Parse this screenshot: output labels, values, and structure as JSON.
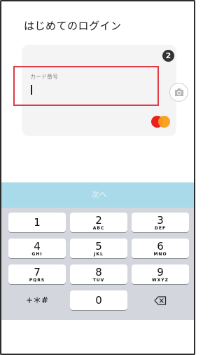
{
  "header": {
    "title": "はじめてのログイン"
  },
  "card": {
    "field_label": "カード番号",
    "field_value": "",
    "brand_icon": "mastercard-logo"
  },
  "step_badge": "2",
  "camera_button_icon": "camera-icon",
  "next_button_label": "次へ",
  "keypad": {
    "keys": [
      {
        "num": "1",
        "letters": ""
      },
      {
        "num": "2",
        "letters": "ABC"
      },
      {
        "num": "3",
        "letters": "DEF"
      },
      {
        "num": "4",
        "letters": "GHI"
      },
      {
        "num": "5",
        "letters": "JKL"
      },
      {
        "num": "6",
        "letters": "MNO"
      },
      {
        "num": "7",
        "letters": "PQRS"
      },
      {
        "num": "8",
        "letters": "TUV"
      },
      {
        "num": "9",
        "letters": "WXYZ"
      },
      {
        "num": "+＊#",
        "letters": ""
      },
      {
        "num": "0",
        "letters": ""
      }
    ],
    "backspace_icon": "backspace-icon"
  },
  "colors": {
    "highlight_border": "#e23a44",
    "next_bar": "#a9dae9",
    "keypad_bg": "#d3d6dc"
  }
}
